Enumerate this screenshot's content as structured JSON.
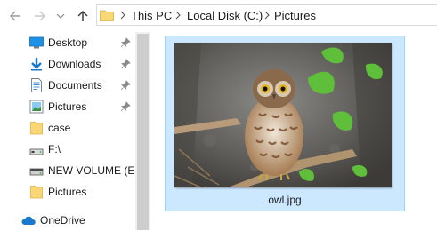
{
  "toolbar": {
    "back_icon": "arrow-left-icon",
    "forward_icon": "arrow-right-icon",
    "recent_icon": "chevron-down-icon",
    "up_icon": "arrow-up-icon"
  },
  "address_bar": {
    "folder_icon": "folder-icon",
    "breadcrumbs": [
      "This PC",
      "Local Disk (C:)",
      "Pictures"
    ]
  },
  "sidebar": {
    "items": [
      {
        "label": "Desktop",
        "icon": "desktop-icon",
        "pinned": true
      },
      {
        "label": "Downloads",
        "icon": "download-arrow-icon",
        "pinned": true
      },
      {
        "label": "Documents",
        "icon": "document-icon",
        "pinned": true
      },
      {
        "label": "Pictures",
        "icon": "pictures-icon",
        "pinned": true
      },
      {
        "label": "case",
        "icon": "folder-icon",
        "pinned": false
      },
      {
        "label": "F:\\",
        "icon": "drive-icon",
        "pinned": false
      },
      {
        "label": "NEW VOLUME (E:)",
        "icon": "drive-icon",
        "pinned": false
      },
      {
        "label": "Pictures",
        "icon": "folder-icon",
        "pinned": false
      },
      {
        "label": "OneDrive",
        "icon": "cloud-icon",
        "pinned": false
      }
    ]
  },
  "files": [
    {
      "name": "owl.jpg",
      "type": "image",
      "selected": true
    }
  ],
  "colors": {
    "selection_fill": "#cce8ff",
    "selection_border": "#99d1ff",
    "folder_yellow": "#f8d775",
    "accent_blue": "#1979ca"
  }
}
